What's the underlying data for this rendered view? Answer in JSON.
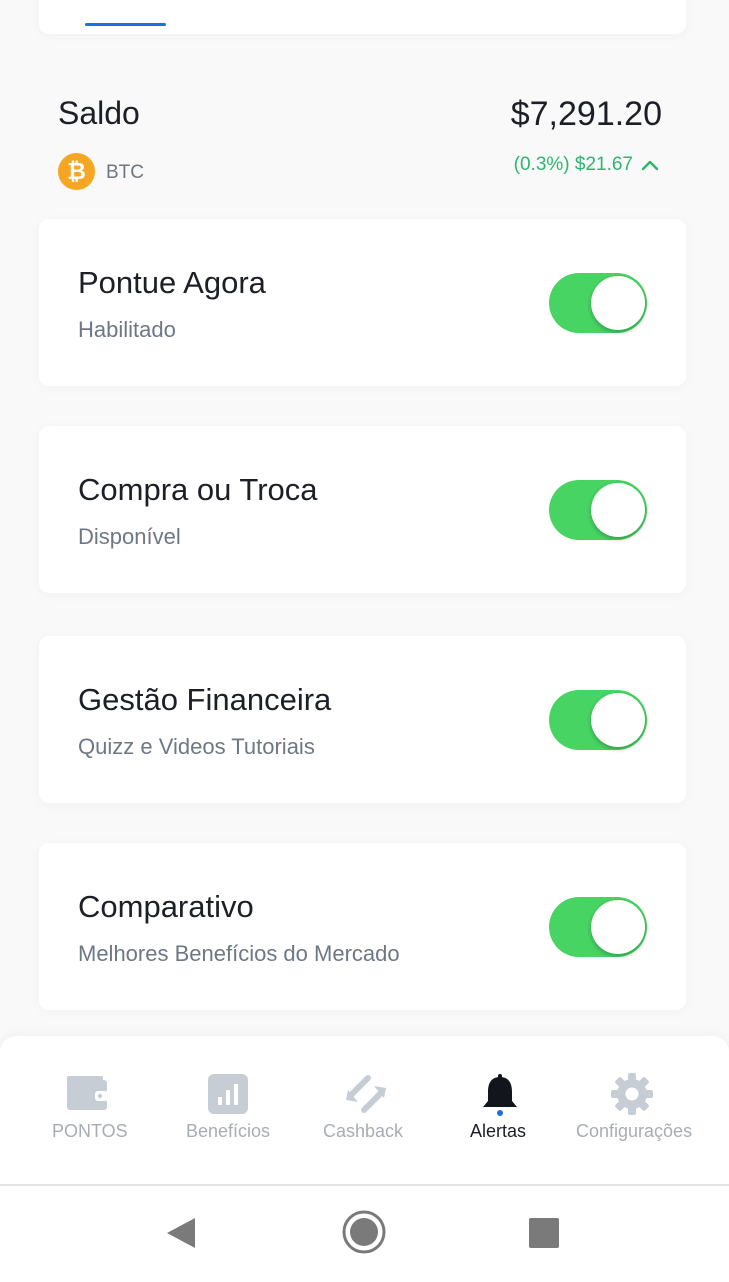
{
  "balance": {
    "label": "Saldo",
    "value": "$7,291.20",
    "coin_symbol": "BTC",
    "coin_icon": "bitcoin-icon",
    "change": "(0.3%) $21.67",
    "change_direction_icon": "chevron-up-icon"
  },
  "features": [
    {
      "title": "Pontue Agora",
      "subtitle": "Habilitado",
      "enabled": true
    },
    {
      "title": "Compra ou Troca",
      "subtitle": "Disponível",
      "enabled": true
    },
    {
      "title": "Gestão Financeira",
      "subtitle": "Quizz e Videos Tutoriais",
      "enabled": true
    },
    {
      "title": "Comparativo",
      "subtitle": "Melhores Benefícios do Mercado",
      "enabled": true
    }
  ],
  "nav": {
    "items": [
      {
        "label": "PONTOS",
        "icon": "wallet-icon"
      },
      {
        "label": "Benefícios",
        "icon": "bar-chart-icon"
      },
      {
        "label": "Cashback",
        "icon": "swap-arrows-icon"
      },
      {
        "label": "Alertas",
        "icon": "bell-icon",
        "active": true
      },
      {
        "label": "Configurações",
        "icon": "gear-icon"
      }
    ]
  },
  "system_nav": [
    "back-icon",
    "home-icon",
    "recents-icon"
  ],
  "colors": {
    "accent_blue": "#1f6fe0",
    "toggle_on": "#47d463",
    "positive_change": "#2fb56f",
    "coin": "#f5a623",
    "inactive_nav": "#a7adb5"
  }
}
